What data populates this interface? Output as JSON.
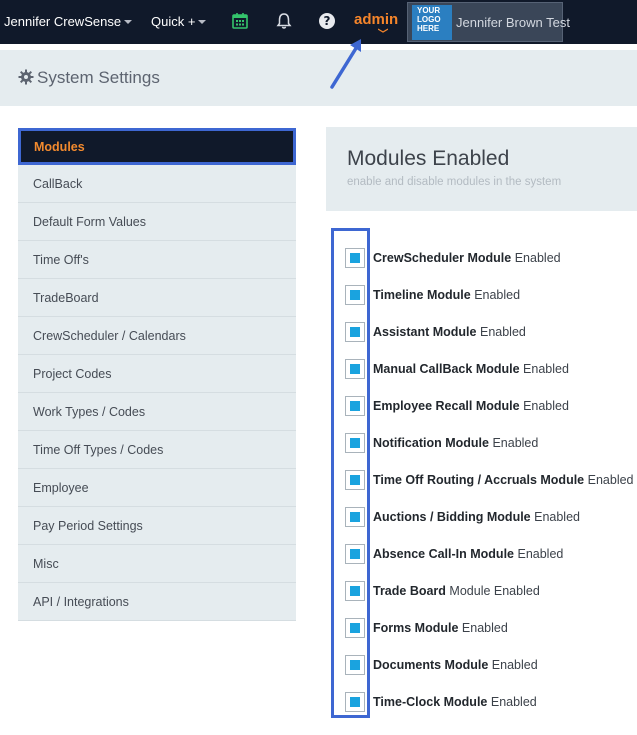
{
  "navbar": {
    "user_name": "Jennifer CrewSense",
    "quick_label": "Quick +",
    "admin_label": "admin",
    "logo_text": "YOUR LOGO HERE",
    "logo_line1": "YOUR",
    "logo_line2": "LOGO",
    "logo_line3": "HERE",
    "account_name": "Jennifer Brown Test",
    "calendar_color": "#34c46c",
    "admin_color": "#f5852b"
  },
  "header": {
    "title": "System Settings",
    "icon": "gear-icon"
  },
  "sidebar": {
    "items": [
      {
        "label": "Modules",
        "active": true
      },
      {
        "label": "CallBack"
      },
      {
        "label": "Default Form Values"
      },
      {
        "label": "Time Off's"
      },
      {
        "label": "TradeBoard"
      },
      {
        "label": "CrewScheduler / Calendars"
      },
      {
        "label": "Project Codes"
      },
      {
        "label": "Work Types / Codes"
      },
      {
        "label": "Time Off Types / Codes"
      },
      {
        "label": "Employee"
      },
      {
        "label": "Pay Period Settings"
      },
      {
        "label": "Misc"
      },
      {
        "label": "API / Integrations"
      }
    ]
  },
  "main": {
    "title": "Modules Enabled",
    "subtitle": "enable and disable modules in the system",
    "enabled_suffix": "Enabled",
    "modules": [
      {
        "name": "CrewScheduler Module",
        "status": "Enabled",
        "checked": true
      },
      {
        "name": "Timeline Module",
        "status": "Enabled",
        "checked": true
      },
      {
        "name": "Assistant Module",
        "status": "Enabled",
        "checked": true
      },
      {
        "name": "Manual CallBack Module",
        "status": "Enabled",
        "checked": true
      },
      {
        "name": "Employee Recall Module",
        "status": "Enabled",
        "checked": true
      },
      {
        "name": "Notification Module",
        "status": "Enabled",
        "checked": true
      },
      {
        "name": "Time Off Routing / Accruals Module",
        "status": "Enabled",
        "checked": true
      },
      {
        "name": "Auctions / Bidding Module",
        "status": "Enabled",
        "checked": true
      },
      {
        "name": "Absence Call-In Module",
        "status": "Enabled",
        "checked": true
      },
      {
        "name": "Trade Board",
        "status": "Module Enabled",
        "checked": true
      },
      {
        "name": "Forms Module",
        "status": "Enabled",
        "checked": true
      },
      {
        "name": "Documents Module",
        "status": "Enabled",
        "checked": true
      },
      {
        "name": "Time-Clock Module",
        "status": "Enabled",
        "checked": true
      }
    ]
  },
  "colors": {
    "navbar_bg": "#10192a",
    "accent_orange": "#f28a2e",
    "highlight_blue": "#3e67d2",
    "checkbox_fill": "#1aa3df",
    "panel_bg": "#e5ecef"
  }
}
